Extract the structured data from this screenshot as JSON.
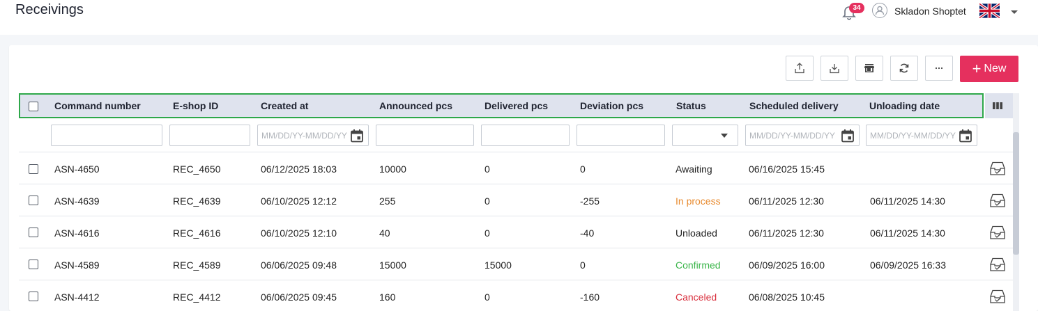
{
  "header": {
    "title": "Receivings",
    "notifications_count": "34",
    "user_name": "Skladon Shoptet"
  },
  "toolbar": {
    "new_label": "New"
  },
  "colors": {
    "accent": "#e5305e",
    "header_bg": "#dfe3ee",
    "header_outline": "#2ea84a",
    "status_in_process": "#e88a2e",
    "status_confirmed": "#3bb54a",
    "status_canceled": "#d9303e"
  },
  "table": {
    "columns": [
      "Command number",
      "E-shop ID",
      "Created at",
      "Announced pcs",
      "Delivered pcs",
      "Deviation pcs",
      "Status",
      "Scheduled delivery",
      "Unloading date"
    ],
    "filters": {
      "date_placeholder": "MM/DD/YY-MM/DD/YY"
    },
    "rows": [
      {
        "command": "ASN-4650",
        "eshop_id": "REC_4650",
        "created": "06/12/2025 18:03",
        "announced": "10000",
        "delivered": "0",
        "deviation": "0",
        "status": "Awaiting",
        "scheduled": "06/16/2025 15:45",
        "unloading": ""
      },
      {
        "command": "ASN-4639",
        "eshop_id": "REC_4639",
        "created": "06/10/2025 12:12",
        "announced": "255",
        "delivered": "0",
        "deviation": "-255",
        "status": "In process",
        "scheduled": "06/11/2025 12:30",
        "unloading": "06/11/2025 14:30"
      },
      {
        "command": "ASN-4616",
        "eshop_id": "REC_4616",
        "created": "06/10/2025 12:10",
        "announced": "40",
        "delivered": "0",
        "deviation": "-40",
        "status": "Unloaded",
        "scheduled": "06/11/2025 12:30",
        "unloading": "06/11/2025 14:30"
      },
      {
        "command": "ASN-4589",
        "eshop_id": "REC_4589",
        "created": "06/06/2025 09:48",
        "announced": "15000",
        "delivered": "15000",
        "deviation": "0",
        "status": "Confirmed",
        "scheduled": "06/09/2025 16:00",
        "unloading": "06/09/2025 16:33"
      },
      {
        "command": "ASN-4412",
        "eshop_id": "REC_4412",
        "created": "06/06/2025 09:45",
        "announced": "160",
        "delivered": "0",
        "deviation": "-160",
        "status": "Canceled",
        "scheduled": "06/08/2025 10:45",
        "unloading": ""
      }
    ]
  }
}
